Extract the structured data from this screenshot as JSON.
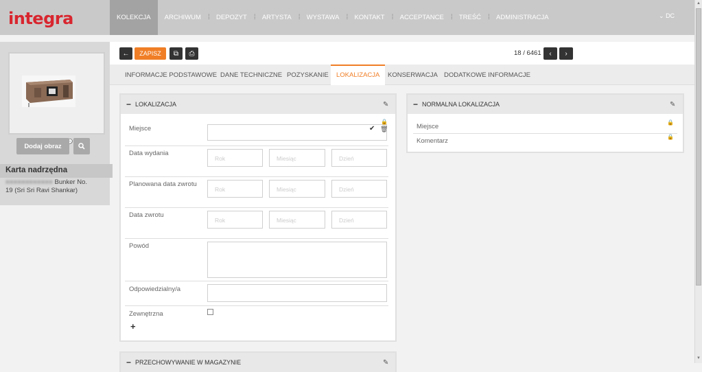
{
  "app": {
    "logo": "integra"
  },
  "nav": {
    "items": [
      "KOLEKCJA",
      "ARCHIWUM",
      "DEPOZYT",
      "ARTYSTA",
      "WYSTAWA",
      "KONTAKT",
      "ACCEPTANCE",
      "TREŚĆ",
      "ADMINISTRACJA"
    ],
    "active_index": 0,
    "user": "DC"
  },
  "sidebar": {
    "add_image_label": "Dodaj obraz",
    "parent_title": "Karta nadrzędna",
    "parent_text_line1_suffix": "Bunker No.",
    "parent_text_line2": "19 (Sri Sri Ravi Shankar)"
  },
  "toolbar": {
    "save_label": "ZAPISZ",
    "pager": "18 / 6461"
  },
  "tabs": {
    "items": [
      "INFORMACJE PODSTAWOWE",
      "DANE TECHNICZNE",
      "POZYSKANIE",
      "LOKALIZACJA",
      "KONSERWACJA",
      "DODATKOWE INFORMACJE"
    ],
    "active_index": 3
  },
  "lokalizacja": {
    "title": "LOKALIZACJA",
    "rows": {
      "miejsce": "Miejsce",
      "data_wydania": "Data wydania",
      "planowana": "Planowana data zwrotu",
      "data_zwrotu": "Data zwrotu",
      "powod": "Powód",
      "odpowiedzialny": "Odpowiedzialny/a",
      "zewnetrzna": "Zewnętrzna"
    },
    "placeholders": {
      "year": "Rok",
      "month": "Miesiąc",
      "day": "Dzień"
    }
  },
  "normalna": {
    "title": "NORMALNA LOKALIZACJA",
    "miejsce": "Miejsce",
    "komentarz": "Komentarz"
  },
  "bottom_panel": {
    "title": "PRZECHOWYWANIE W MAGAZYNIE"
  },
  "colors": {
    "accent": "#f07e26",
    "brand": "#d8262f"
  }
}
